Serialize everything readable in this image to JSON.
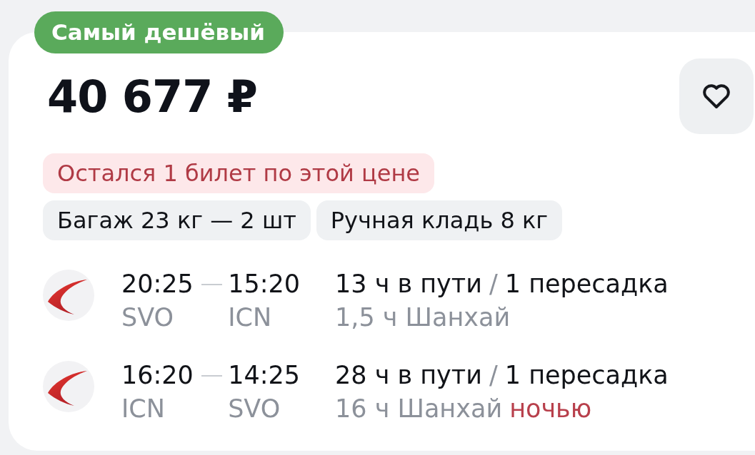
{
  "badge": "Самый дешёвый",
  "price": "40 677 ₽",
  "alert": "Остался 1 билет по этой цене",
  "baggage": [
    {
      "label": "Багаж 23 кг — 2 шт"
    },
    {
      "label": "Ручная кладь 8 кг"
    }
  ],
  "flights": [
    {
      "departure_time": "20:25",
      "arrival_time": "15:20",
      "from": "SVO",
      "to": "ICN",
      "duration": "13 ч в пути",
      "separator": "/",
      "stops": "1 пересадка",
      "layover": "1,5 ч Шанхай"
    },
    {
      "departure_time": "16:20",
      "arrival_time": "14:25",
      "from": "ICN",
      "to": "SVO",
      "duration": "28 ч в пути",
      "separator": "/",
      "stops": "1 пересадка",
      "layover": "16 ч Шанхай",
      "layover_note": "ночью"
    }
  ]
}
